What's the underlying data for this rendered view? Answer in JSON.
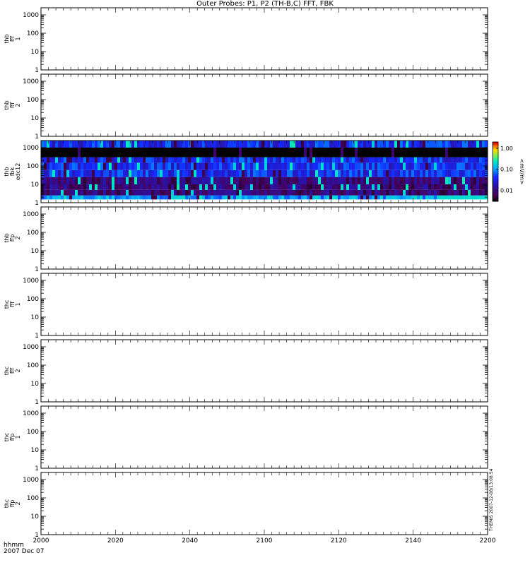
{
  "title": "Outer Probes: P1, P2 (TH-B,C) FFT, FBK",
  "footer": {
    "time_format": "hhmm",
    "date": "2007 Dec 07"
  },
  "side_stamp": "THEMIS  2007-12-08/13:08:54",
  "colors": {
    "axis": "#000000",
    "background": "#ffffff"
  },
  "chart_data": [
    {
      "type": "heatmap",
      "panel_label": [
        "thb",
        "fff",
        "1"
      ],
      "x_range": [
        "2000",
        "2200"
      ],
      "y_scale": "log",
      "ylim": [
        1,
        1000
      ],
      "y_ticks": [
        "1",
        "10",
        "100",
        "1000"
      ],
      "data": "empty"
    },
    {
      "type": "heatmap",
      "panel_label": [
        "thb",
        "fff",
        "2"
      ],
      "x_range": [
        "2000",
        "2200"
      ],
      "y_scale": "log",
      "ylim": [
        1,
        1000
      ],
      "y_ticks": [
        "1",
        "10",
        "100",
        "1000"
      ],
      "data": "empty"
    },
    {
      "type": "heatmap",
      "panel_label": [
        "thb",
        "fbk",
        "edc12"
      ],
      "x_range": [
        "2000",
        "2200"
      ],
      "y_scale": "log",
      "ylim": [
        1,
        1000
      ],
      "y_ticks": [
        "1",
        "10",
        "100",
        "1000"
      ],
      "colorbar": {
        "label": "<mV/m>",
        "scale": "log",
        "range": [
          0.003,
          2.0
        ],
        "ticks": [
          "0.01",
          "0.10",
          "1.00"
        ]
      },
      "bands": [
        {
          "f_low": 1.5,
          "f_high": 2.5,
          "level": "high"
        },
        {
          "f_low": 2.5,
          "f_high": 5,
          "level": "low"
        },
        {
          "f_low": 5,
          "f_high": 10,
          "level": "low"
        },
        {
          "f_low": 10,
          "f_high": 25,
          "level": "low"
        },
        {
          "f_low": 25,
          "f_high": 60,
          "level": "medium"
        },
        {
          "f_low": 60,
          "f_high": 150,
          "level": "medium"
        },
        {
          "f_low": 150,
          "f_high": 300,
          "level": "medium"
        },
        {
          "f_low": 300,
          "f_high": 1000,
          "level": "none"
        },
        {
          "f_low": 1000,
          "f_high": 2000,
          "level": "medium"
        }
      ]
    },
    {
      "type": "heatmap",
      "panel_label": [
        "thb",
        "ffp",
        "2"
      ],
      "x_range": [
        "2000",
        "2200"
      ],
      "y_scale": "log",
      "ylim": [
        1,
        1000
      ],
      "y_ticks": [
        "1",
        "10",
        "100",
        "1000"
      ],
      "data": "empty"
    },
    {
      "type": "heatmap",
      "panel_label": [
        "thc",
        "fff",
        "1"
      ],
      "x_range": [
        "2000",
        "2200"
      ],
      "y_scale": "log",
      "ylim": [
        1,
        1000
      ],
      "y_ticks": [
        "1",
        "10",
        "100",
        "1000"
      ],
      "data": "empty"
    },
    {
      "type": "heatmap",
      "panel_label": [
        "thc",
        "fff",
        "2"
      ],
      "x_range": [
        "2000",
        "2200"
      ],
      "y_scale": "log",
      "ylim": [
        1,
        1000
      ],
      "y_ticks": [
        "1",
        "10",
        "100",
        "1000"
      ],
      "data": "empty"
    },
    {
      "type": "heatmap",
      "panel_label": [
        "thc",
        "ffp",
        "1"
      ],
      "x_range": [
        "2000",
        "2200"
      ],
      "y_scale": "log",
      "ylim": [
        1,
        1000
      ],
      "y_ticks": [
        "1",
        "10",
        "100",
        "1000"
      ],
      "data": "empty"
    },
    {
      "type": "heatmap",
      "panel_label": [
        "thc",
        "ffp",
        "2"
      ],
      "x_range": [
        "2000",
        "2200"
      ],
      "y_scale": "log",
      "ylim": [
        1,
        1000
      ],
      "y_ticks": [
        "1",
        "10",
        "100",
        "1000"
      ],
      "data": "empty"
    }
  ],
  "x_axis": {
    "ticks": [
      "2000",
      "2020",
      "2040",
      "2100",
      "2120",
      "2140",
      "2200"
    ]
  }
}
